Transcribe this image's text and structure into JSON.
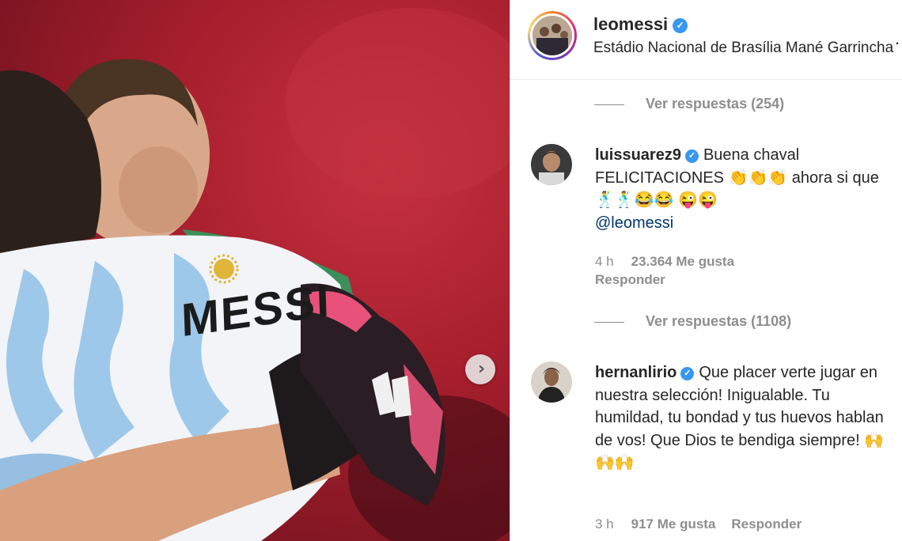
{
  "post": {
    "username": "leomessi",
    "location": "Estádio Nacional de Brasília Mané Garrincha",
    "verified_icon": "verified-badge-icon",
    "more_label": "..."
  },
  "photo": {
    "jersey_text": "MESSI",
    "next_icon": "chevron-right-icon",
    "next_glyph": "›"
  },
  "replies_1": {
    "label": "Ver respuestas (254)"
  },
  "comment_1": {
    "username": "luissuarez9",
    "text": "Buena chaval FELICITACIONES 👏👏👏 ahora si que 🕺🕺😂😂 😜😜",
    "mention": "@leomessi",
    "time": "4 h",
    "likes": "23.364 Me gusta",
    "reply": "Responder"
  },
  "replies_2": {
    "label": "Ver respuestas (1108)"
  },
  "comment_2": {
    "username": "hernanlirio",
    "text": "Que placer verte jugar en nuestra selección! Inigualable. Tu humildad, tu bondad y tus huevos hablan de vos! Que Dios te bendiga siempre! 🙌🙌🙌",
    "time": "3 h",
    "likes": "917 Me gusta",
    "reply": "Responder"
  },
  "colors": {
    "accent_blue": "#3897f0",
    "mention": "#00376b",
    "muted": "#8e8e8e",
    "text": "#262626",
    "photo_bg": "#a81f2e"
  }
}
